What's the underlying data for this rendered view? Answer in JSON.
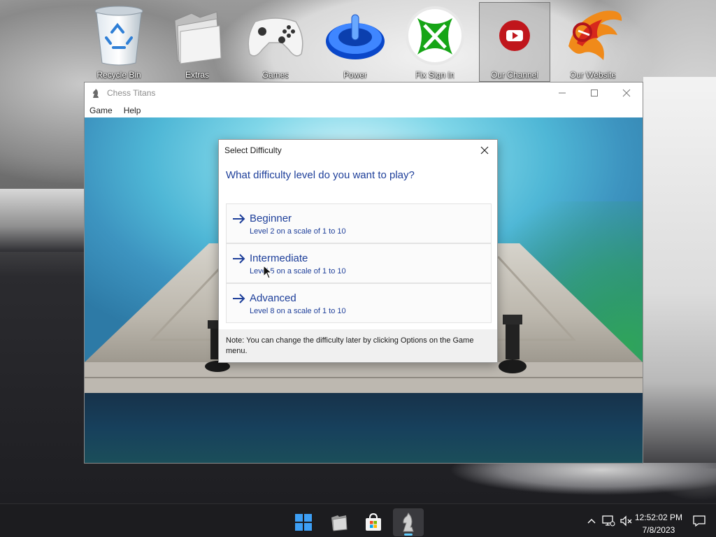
{
  "desktop": {
    "icons": [
      {
        "label": "Recycle Bin",
        "icon": "recycle-bin-icon"
      },
      {
        "label": "Extras",
        "icon": "folder-icon"
      },
      {
        "label": "Games",
        "icon": "game-controller-icon"
      },
      {
        "label": "Power",
        "icon": "power-icon"
      },
      {
        "label": "Fix Sign In",
        "icon": "xbox-icon"
      },
      {
        "label": "Our Channel",
        "icon": "youtube-icon"
      },
      {
        "label": "Our Website",
        "icon": "phoenix-logo-icon"
      }
    ]
  },
  "window": {
    "title": "Chess Titans",
    "menu": [
      "Game",
      "Help"
    ]
  },
  "dialog": {
    "title": "Select Difficulty",
    "question": "What difficulty level do you want to play?",
    "options": [
      {
        "name": "Beginner",
        "desc": "Level 2 on a scale of 1 to 10"
      },
      {
        "name": "Intermediate",
        "desc": "Level 5 on a scale of 1 to 10"
      },
      {
        "name": "Advanced",
        "desc": "Level 8 on a scale of 1 to 10"
      }
    ],
    "note": "Note: You can change the difficulty later by clicking Options on the Game menu."
  },
  "taskbar": {
    "apps": [
      "start-icon",
      "file-explorer-icon",
      "store-icon",
      "chess-titans-icon"
    ],
    "time": "12:52:02 PM",
    "date": "7/8/2023"
  },
  "colors": {
    "accent_text": "#1e3f9a",
    "taskbar_bg": "#1c1c1f",
    "active_indicator": "#60cdff"
  }
}
